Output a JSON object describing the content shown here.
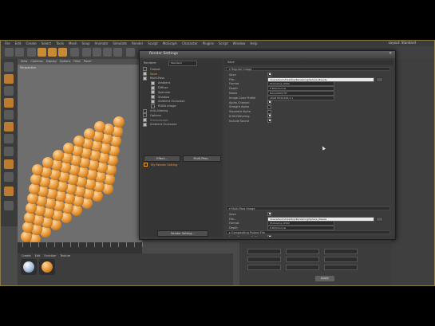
{
  "app": {
    "menu": [
      "File",
      "Edit",
      "Create",
      "Select",
      "Tools",
      "Mesh",
      "Snap",
      "Animate",
      "Simulate",
      "Render",
      "Sculpt",
      "MoGraph",
      "Character",
      "Plugins",
      "Script",
      "Window",
      "Help"
    ],
    "layout_label": "Layout",
    "layout_value": "Standard"
  },
  "viewport": {
    "menu": [
      "View",
      "Cameras",
      "Display",
      "Options",
      "Filter",
      "Panel"
    ],
    "label": "Perspective"
  },
  "material_manager": {
    "menu": [
      "Create",
      "Edit",
      "Function",
      "Texture"
    ]
  },
  "coordinates": {
    "apply_label": "Apply"
  },
  "render_settings": {
    "title": "Render Settings",
    "close": "✕",
    "renderer_label": "Renderer",
    "renderer_value": "Standard",
    "tree": [
      {
        "label": "Output",
        "checked": false,
        "indent": 0,
        "state": "normal"
      },
      {
        "label": "Save",
        "checked": true,
        "indent": 0,
        "state": "selected"
      },
      {
        "label": "Multi-Pass",
        "checked": true,
        "indent": 0,
        "state": "normal"
      },
      {
        "label": "Ambient",
        "checked": true,
        "indent": 1,
        "state": "normal"
      },
      {
        "label": "Diffuse",
        "checked": true,
        "indent": 1,
        "state": "normal"
      },
      {
        "label": "Specular",
        "checked": true,
        "indent": 1,
        "state": "normal"
      },
      {
        "label": "Shadow",
        "checked": true,
        "indent": 1,
        "state": "normal"
      },
      {
        "label": "Ambient Occlusion",
        "checked": true,
        "indent": 1,
        "state": "normal"
      },
      {
        "label": "RGBA Image",
        "checked": false,
        "indent": 1,
        "state": "normal"
      },
      {
        "label": "Anti-Aliasing",
        "checked": false,
        "indent": 0,
        "state": "normal"
      },
      {
        "label": "Options",
        "checked": false,
        "indent": 0,
        "state": "normal"
      },
      {
        "label": "Stereoscopic",
        "checked": true,
        "indent": 0,
        "state": "dim"
      },
      {
        "label": "Ambient Occlusion",
        "checked": true,
        "indent": 0,
        "state": "normal"
      }
    ],
    "effect_button": "Effect...",
    "multipass_button": "Multi-Pass...",
    "my_render_setting": "My Render Setting",
    "render_setting_button": "Render Setting...",
    "tab_label": "Save",
    "regular_image": {
      "header": "Regular Image",
      "rows": [
        {
          "label": "Save",
          "type": "check",
          "on": true
        },
        {
          "label": "File...",
          "type": "path",
          "value": "/Users/kevin/Desktop/Rendering/Sphere_Beauty"
        },
        {
          "label": "Format",
          "type": "dropdown",
          "value": "Photoshop (PSD)"
        },
        {
          "label": "Depth",
          "type": "dropdown",
          "value": "8 Bit/Channel"
        },
        {
          "label": "Name",
          "type": "dropdown",
          "value": "Name0000.TIF"
        },
        {
          "label": "Image Color Profile",
          "type": "dropdown",
          "value": "sRGB IEC61966-2.1"
        },
        {
          "label": "Alpha Channel",
          "type": "check",
          "on": true
        },
        {
          "label": "Straight Alpha",
          "type": "check",
          "on": false
        },
        {
          "label": "Separate Alpha",
          "type": "check",
          "on": false
        },
        {
          "label": "8 Bit Dithering",
          "type": "check",
          "on": true
        },
        {
          "label": "Include Sound",
          "type": "check",
          "on": true
        }
      ]
    },
    "multipass_image": {
      "header": "Multi-Pass Image",
      "rows": [
        {
          "label": "Save",
          "type": "check",
          "on": true
        },
        {
          "label": "File...",
          "type": "path",
          "value": "/Users/kevin/Desktop/Rendering/Sphere_Passes"
        },
        {
          "label": "Format",
          "type": "dropdown",
          "value": "Photoshop (PSD)"
        },
        {
          "label": "Depth",
          "type": "dropdown",
          "value": "8 Bit/Channel"
        },
        {
          "label": "Multi-Layer File",
          "type": "check",
          "on": true
        },
        {
          "label": "Layer Name as Suffix",
          "type": "check",
          "on": true
        },
        {
          "label": "Straight Alpha",
          "type": "check",
          "on": false
        }
      ]
    },
    "compositing_header": "Compositing Project File"
  }
}
